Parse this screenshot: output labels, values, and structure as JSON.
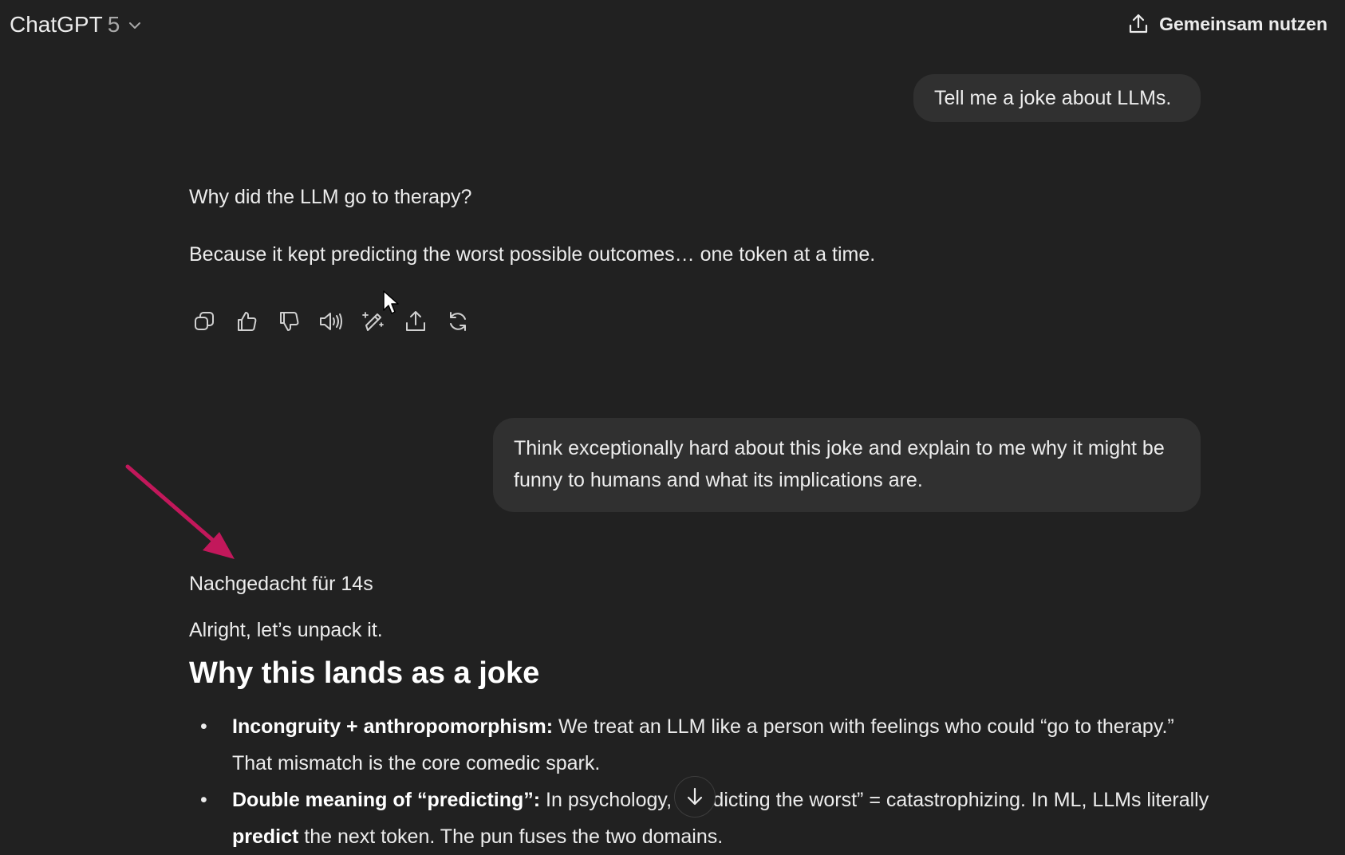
{
  "header": {
    "model_name": "ChatGPT",
    "model_version": "5",
    "share_label": "Gemeinsam nutzen"
  },
  "conversation": {
    "user_message_1": "Tell me a joke about LLMs.",
    "assistant_1_line1": "Why did the LLM go to therapy?",
    "assistant_1_line2": "Because it kept predicting the worst possible outcomes… one token at a time.",
    "user_message_2": "Think exceptionally hard about this joke and explain to me why it might be funny to humans and what its implications are.",
    "thought_label": "Nachgedacht für 14s",
    "assistant_2_intro": "Alright, let’s unpack it.",
    "assistant_2_heading": "Why this lands as a joke",
    "bullet_1_bold": "Incongruity + anthropomorphism:",
    "bullet_1_text": " We treat an LLM like a person with feelings who could “go to therapy.” That mismatch is the core comedic spark.",
    "bullet_2_bold": "Double meaning of “predicting”:",
    "bullet_2_text_a": " In psychology, “predicting the worst” = catastrophizing. In ML, LLMs literally ",
    "bullet_2_bold2": "predict",
    "bullet_2_text_b": " the next token. The pun fuses the two domains."
  },
  "actions": [
    "copy-icon",
    "thumbs-up-icon",
    "thumbs-down-icon",
    "read-aloud-icon",
    "edit-in-canvas-icon",
    "share-icon",
    "regenerate-icon"
  ],
  "colors": {
    "background": "#212121",
    "bubble": "#303030",
    "text": "#ececec",
    "annotation_arrow": "#c2185b"
  }
}
